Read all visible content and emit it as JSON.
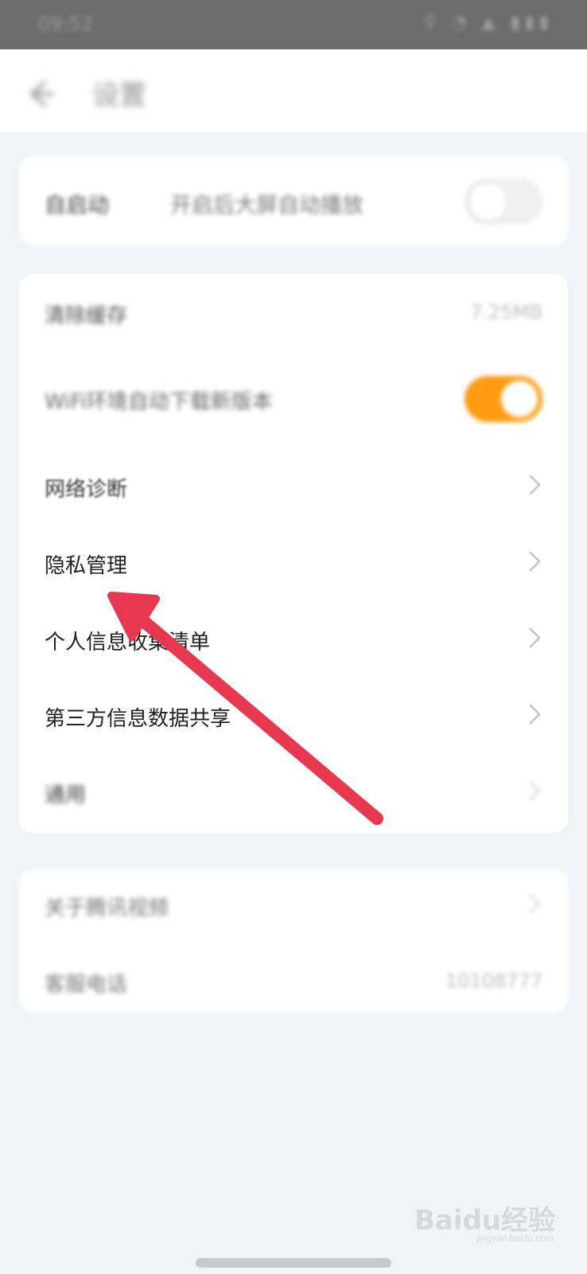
{
  "status_bar": {
    "time": "09:52",
    "icons": "⚲ ◔ ▲ ▮▮▮"
  },
  "header": {
    "title": "设置"
  },
  "top_card": {
    "label": "自启动",
    "description": "开启后大屏自动播放"
  },
  "main_card": {
    "rows": [
      {
        "label": "清除缓存",
        "value": "7.25MB"
      },
      {
        "label": "WiFi环境自动下载新版本"
      },
      {
        "label": "网络诊断"
      },
      {
        "label": "隐私管理"
      },
      {
        "label": "个人信息收集清单"
      },
      {
        "label": "第三方信息数据共享"
      },
      {
        "label": "通用"
      }
    ]
  },
  "bottom_card": {
    "rows": [
      {
        "label": "关于腾讯视频"
      },
      {
        "label": "客服电话",
        "value": "10108777"
      }
    ]
  },
  "watermark": {
    "brand": "Baidu经验",
    "url": "jingyan.baidu.com"
  },
  "colors": {
    "accent_orange": "#ff9c12",
    "annotation_red": "#e8384f",
    "chevron": "#c2c2c2"
  }
}
